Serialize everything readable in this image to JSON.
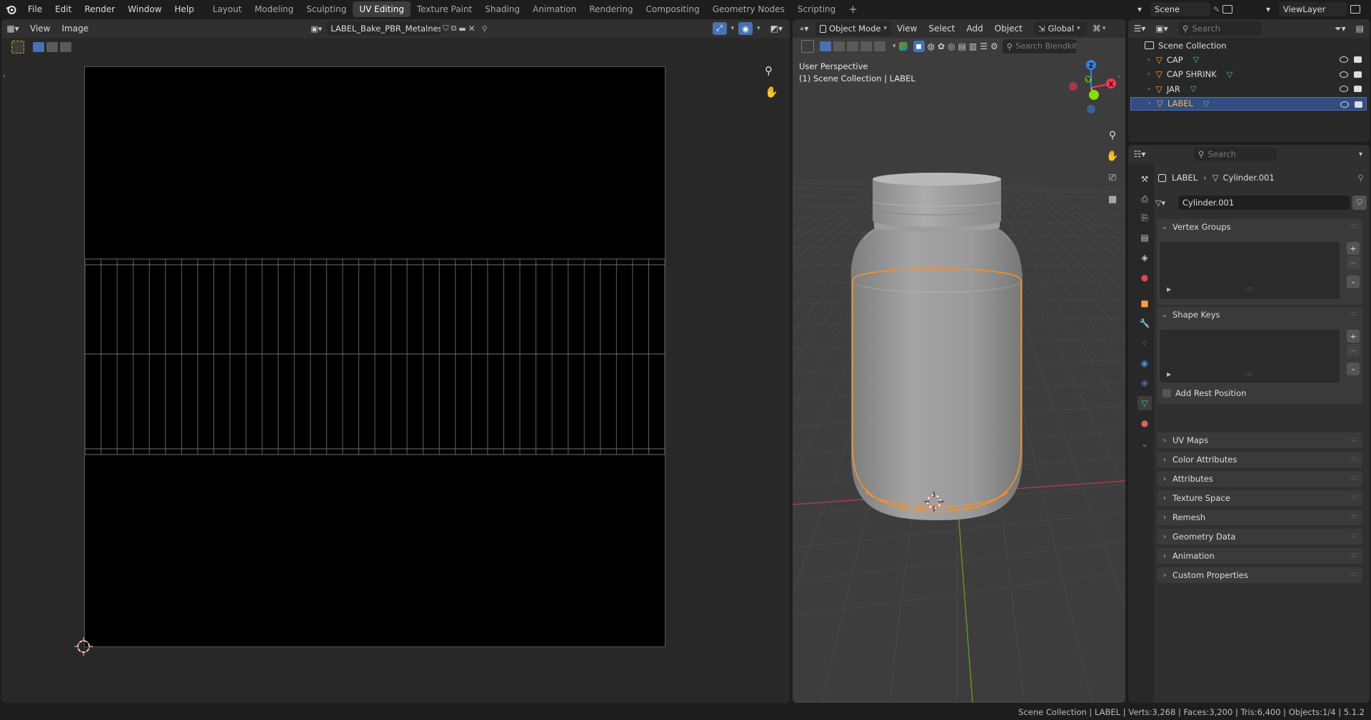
{
  "topbar": {
    "menus": [
      "File",
      "Edit",
      "Render",
      "Window",
      "Help"
    ],
    "workspaces": [
      "Layout",
      "Modeling",
      "Sculpting",
      "UV Editing",
      "Texture Paint",
      "Shading",
      "Animation",
      "Rendering",
      "Compositing",
      "Geometry Nodes",
      "Scripting"
    ],
    "active_workspace": "UV Editing",
    "add_tab": "+",
    "scene": "Scene",
    "view_layer": "ViewLayer"
  },
  "uv_editor": {
    "menus": [
      "View",
      "Image"
    ],
    "image_name": "LABEL_Bake_PBR_Metalness"
  },
  "viewport": {
    "mode": "Object Mode",
    "menus": [
      "View",
      "Select",
      "Add",
      "Object"
    ],
    "orientation": "Global",
    "search_placeholder": "Search Blendkit",
    "overlay_title": "User Perspective",
    "overlay_subtitle": "(1) Scene Collection | LABEL",
    "gizmo": {
      "z": "Z",
      "y": "Y",
      "x": "X"
    }
  },
  "outliner": {
    "search_placeholder": "Search",
    "collection": "Scene Collection",
    "items": [
      {
        "name": "CAP",
        "selected": false
      },
      {
        "name": "CAP SHRINK",
        "selected": false
      },
      {
        "name": "JAR",
        "selected": false
      },
      {
        "name": "LABEL",
        "selected": true
      }
    ]
  },
  "properties": {
    "search_placeholder": "Search",
    "breadcrumb_object": "LABEL",
    "breadcrumb_data": "Cylinder.001",
    "mesh_name": "Cylinder.001",
    "sections": {
      "vertex_groups": "Vertex Groups",
      "shape_keys": "Shape Keys",
      "add_rest_position": "Add Rest Position"
    },
    "collapsed_panels": [
      "UV Maps",
      "Color Attributes",
      "Attributes",
      "Texture Space",
      "Remesh",
      "Geometry Data",
      "Animation",
      "Custom Properties"
    ]
  },
  "statusbar": {
    "text": "Scene Collection | LABEL | Verts:3,268 | Faces:3,200 | Tris:6,400 | Objects:1/4 | 5.1.2"
  },
  "colors": {
    "accent_blue": "#4772b3",
    "selection_orange": "#ff8f1f",
    "axis_red": "#ff3352",
    "axis_green": "#8bdc00",
    "axis_blue": "#2f83e0"
  }
}
